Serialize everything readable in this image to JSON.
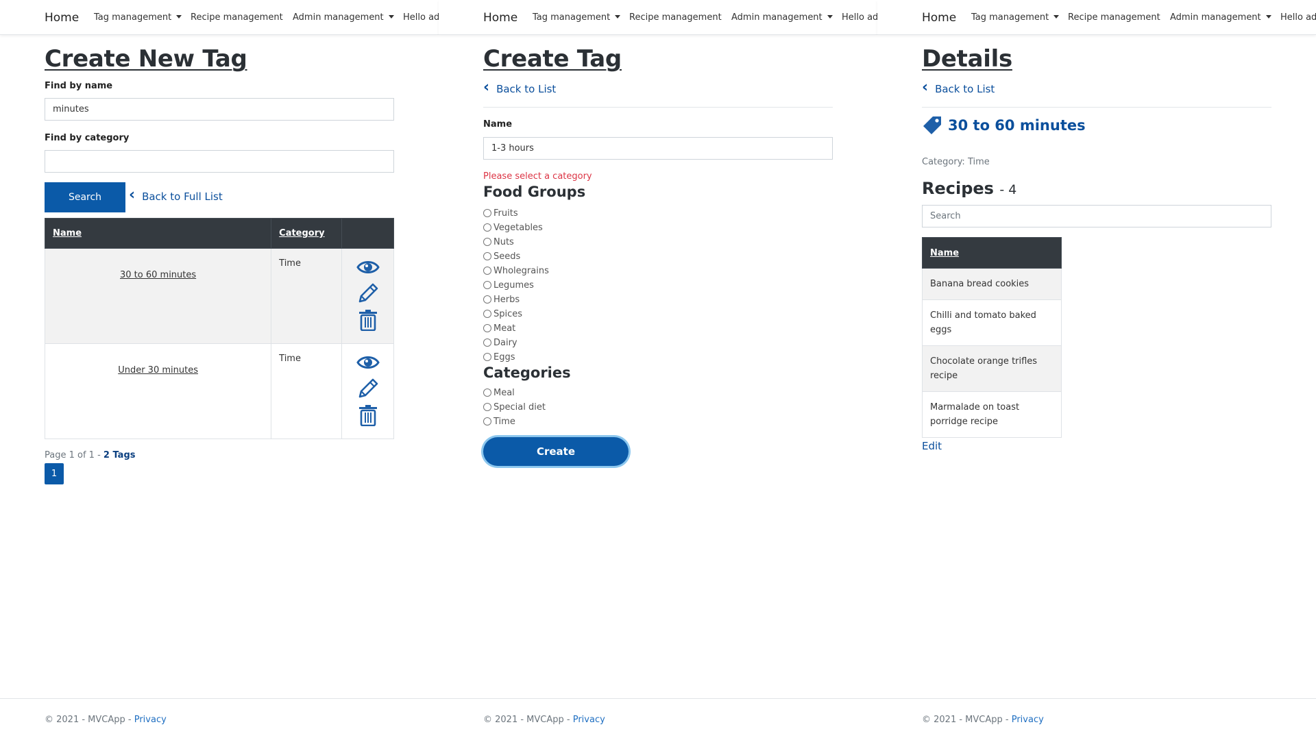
{
  "nav": {
    "home": "Home",
    "tag_management": "Tag management",
    "recipe_management": "Recipe management",
    "admin_management": "Admin management",
    "hello": "Hello ad"
  },
  "footer": {
    "copyright": "© 2021 - MVCApp - ",
    "privacy": "Privacy"
  },
  "search_page": {
    "title": "Create New Tag",
    "find_by_name_label": "Find by name",
    "find_by_name_value": "minutes",
    "find_by_category_label": "Find by category",
    "find_by_category_value": "",
    "search_button": "Search",
    "back_link": "Back to Full List",
    "table": {
      "headers": [
        "Name",
        "Category",
        ""
      ],
      "rows": [
        {
          "name": "30 to 60 minutes",
          "category": "Time"
        },
        {
          "name": "Under 30 minutes",
          "category": "Time"
        }
      ]
    },
    "pager": {
      "text": "Page 1 of 1 - ",
      "count": "2 Tags",
      "current_page": "1"
    }
  },
  "create_page": {
    "title": "Create Tag",
    "back_link": "Back to List",
    "name_label": "Name",
    "name_value": "1-3 hours",
    "error": "Please select a category",
    "food_groups_heading": "Food Groups",
    "food_groups": [
      "Fruits",
      "Vegetables",
      "Nuts",
      "Seeds",
      "Wholegrains",
      "Legumes",
      "Herbs",
      "Spices",
      "Meat",
      "Dairy",
      "Eggs"
    ],
    "categories_heading": "Categories",
    "categories": [
      "Meal",
      "Special diet",
      "Time"
    ],
    "create_button": "Create"
  },
  "details_page": {
    "title": "Details",
    "back_link": "Back to List",
    "tag_name": "30 to 60 minutes",
    "category_text": "Category: Time",
    "recipes_heading": "Recipes",
    "recipes_count": "- 4",
    "search_placeholder": "Search",
    "table_header": "Name",
    "recipes": [
      "Banana bread cookies",
      "Chilli and tomato baked eggs",
      "Chocolate orange trifles recipe",
      "Marmalade on toast porridge recipe"
    ],
    "edit_link": "Edit"
  },
  "colors": {
    "primary": "#0b5aa8",
    "link": "#0b4f9c",
    "header_dark": "#343a40",
    "error": "#dc3545"
  }
}
